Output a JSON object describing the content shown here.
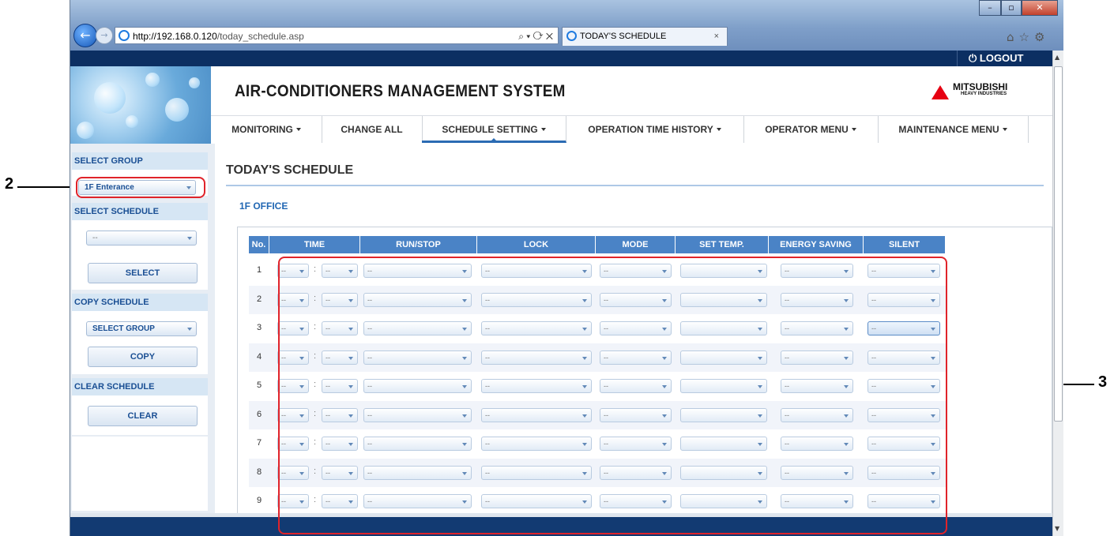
{
  "browser": {
    "address_host": "http://192.168.0.120",
    "address_path": "/today_schedule.asp",
    "address_tools": "⌕ ▾ ⟳ ✕",
    "tab_title": "TODAY'S SCHEDULE",
    "tab_close": "×",
    "win_min": "–",
    "win_max": "▫",
    "win_close": "✕",
    "tool_icons": "⌂☆⚙"
  },
  "app": {
    "logout_label": "⏻ LOGOUT",
    "title": "AIR-CONDITIONERS MANAGEMENT SYSTEM",
    "logo_name": "MITSUBISHI",
    "logo_sub": "HEAVY INDUSTRIES"
  },
  "menu": {
    "items": [
      {
        "label": "MONITORING"
      },
      {
        "label": "CHANGE ALL"
      },
      {
        "label": "SCHEDULE SETTING"
      },
      {
        "label": "OPERATION TIME HISTORY"
      },
      {
        "label": "OPERATOR MENU"
      },
      {
        "label": "MAINTENANCE MENU"
      }
    ],
    "active": "SCHEDULE SETTING"
  },
  "sidebar": {
    "select_group_heading": "SELECT GROUP",
    "group_value": "1F Enterance",
    "select_schedule_heading": "SELECT SCHEDULE",
    "schedule_value": "--",
    "select_button": "SELECT",
    "copy_schedule_heading": "COPY SCHEDULE",
    "copy_group_value": "SELECT GROUP",
    "copy_button": "COPY",
    "clear_schedule_heading": "CLEAR SCHEDULE",
    "clear_button": "CLEAR"
  },
  "main": {
    "page_title": "TODAY'S SCHEDULE",
    "group_name": "1F OFFICE",
    "columns": [
      "No.",
      "TIME",
      "RUN/STOP",
      "LOCK",
      "MODE",
      "SET TEMP.",
      "ENERGY SAVING",
      "SILENT"
    ],
    "row_numbers": [
      "1",
      "2",
      "3",
      "4",
      "5",
      "6",
      "7",
      "8",
      "9"
    ],
    "cell_placeholder": "--",
    "time_separator": ":"
  },
  "callouts": {
    "left": "2",
    "right": "3"
  },
  "colors": {
    "header_blue": "#4a83c6",
    "nav_dark": "#0c2f62",
    "highlight_red": "#e0232a",
    "accent_text": "#1a4f94"
  }
}
